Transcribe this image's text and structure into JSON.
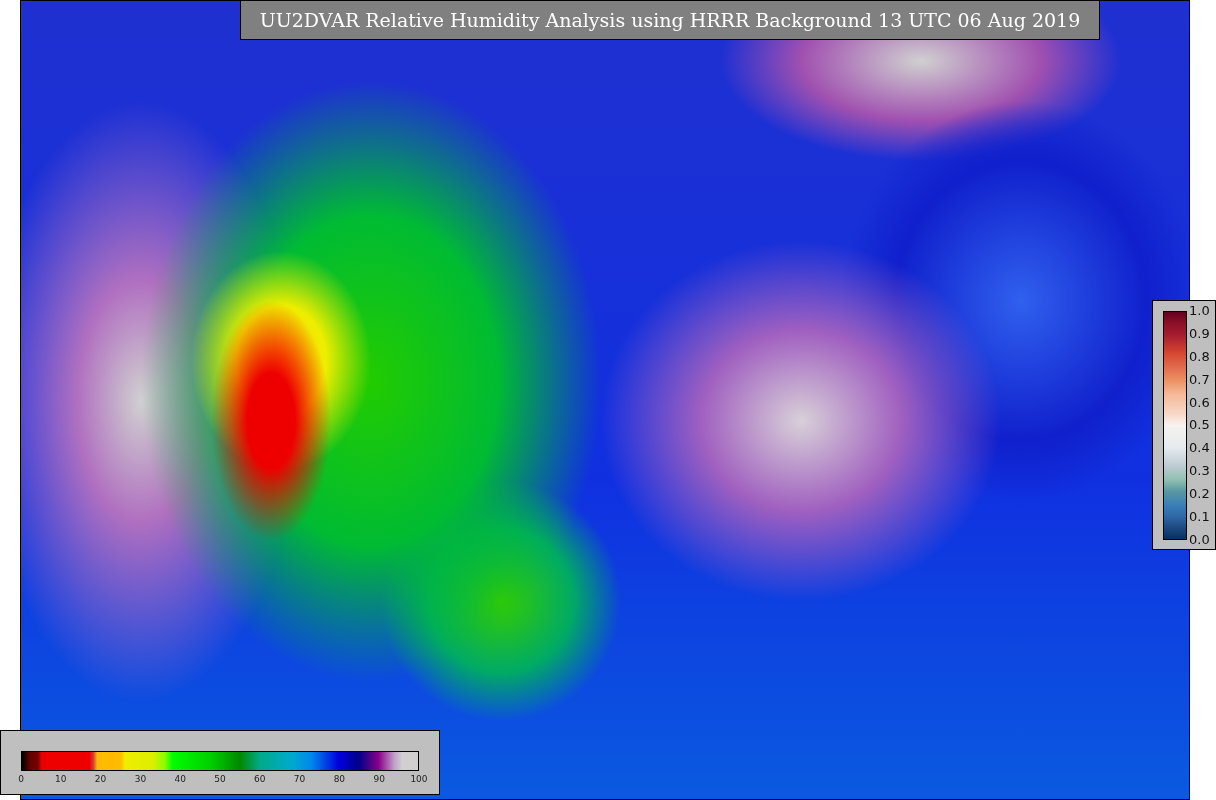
{
  "title": "UU2DVAR Relative Humidity Analysis using HRRR Background 13 UTC 06 Aug 2019",
  "humidity_colorbar": {
    "ticks": [
      "0",
      "10",
      "20",
      "30",
      "40",
      "50",
      "60",
      "70",
      "80",
      "90",
      "100"
    ]
  },
  "station_colorbar": {
    "ticks": [
      "1.0",
      "0.9",
      "0.8",
      "0.7",
      "0.6",
      "0.5",
      "0.4",
      "0.3",
      "0.2",
      "0.1",
      "0.0"
    ]
  }
}
